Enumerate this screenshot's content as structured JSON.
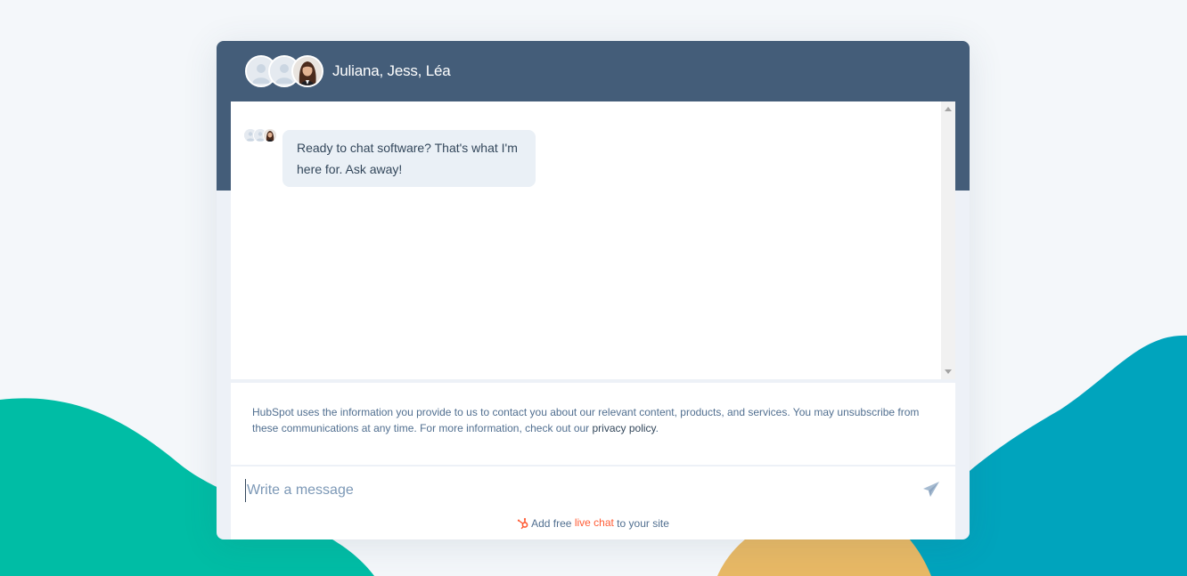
{
  "header": {
    "title": "Juliana, Jess, Léa",
    "avatars": [
      "user-placeholder-icon",
      "user-placeholder-icon",
      "photo-avatar"
    ]
  },
  "messages": [
    {
      "sender": "bot",
      "text": "Ready to chat software? That's what I'm here for. Ask away!"
    }
  ],
  "consent": {
    "text": "HubSpot uses the information you provide to us to contact you about our relevant content, products, and services. You may unsubscribe from these communications at any time. For more information, check out our ",
    "link_label": "privacy policy",
    "suffix": "."
  },
  "composer": {
    "placeholder": "Write a message",
    "value": ""
  },
  "branding": {
    "prefix": "Add free ",
    "link_label": "live chat",
    "suffix": " to your site"
  },
  "colors": {
    "header_bg": "#445d79",
    "bubble_bg": "#eaf0f6",
    "accent_orange": "#ff5c35",
    "teal_left": "#00bda5",
    "teal_right": "#00a4bd",
    "yellow": "#e8b965"
  }
}
